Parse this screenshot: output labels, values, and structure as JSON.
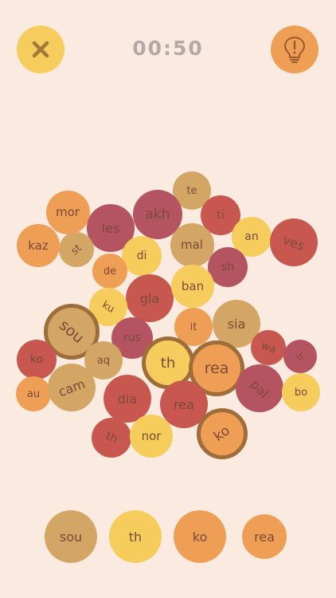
{
  "header": {
    "timer": "00:50",
    "close_icon": "close-x-icon",
    "hint_icon": "lightbulb-exclamation-icon"
  },
  "colors": {
    "background": "#fbeadf",
    "yellow": "#f6cd5c",
    "orange": "#ef9f55",
    "tan": "#d4a665",
    "red": "#c8584f",
    "maroon": "#b55461",
    "selected_border": "#9e6d3a",
    "text": "#7a4a3a",
    "timer": "#b3a9a6"
  },
  "bubbles": [
    {
      "text": "te",
      "color": "tan",
      "selected": false
    },
    {
      "text": "mor",
      "color": "orange",
      "selected": false
    },
    {
      "text": "les",
      "color": "maroon",
      "selected": false
    },
    {
      "text": "akh",
      "color": "maroon",
      "selected": false
    },
    {
      "text": "ti",
      "color": "red",
      "selected": false
    },
    {
      "text": "kaz",
      "color": "orange",
      "selected": false
    },
    {
      "text": "st",
      "color": "tan",
      "selected": false
    },
    {
      "text": "di",
      "color": "yellow",
      "selected": false
    },
    {
      "text": "mal",
      "color": "tan",
      "selected": false
    },
    {
      "text": "an",
      "color": "yellow",
      "selected": false
    },
    {
      "text": "ves",
      "color": "red",
      "selected": false
    },
    {
      "text": "de",
      "color": "orange",
      "selected": false
    },
    {
      "text": "sh",
      "color": "maroon",
      "selected": false
    },
    {
      "text": "gla",
      "color": "red",
      "selected": false
    },
    {
      "text": "ban",
      "color": "yellow",
      "selected": false
    },
    {
      "text": "ku",
      "color": "yellow",
      "selected": false
    },
    {
      "text": "sou",
      "color": "tan",
      "selected": true
    },
    {
      "text": "rus",
      "color": "maroon",
      "selected": false
    },
    {
      "text": "it",
      "color": "orange",
      "selected": false
    },
    {
      "text": "sia",
      "color": "tan",
      "selected": false
    },
    {
      "text": "ko",
      "color": "red",
      "selected": false
    },
    {
      "text": "aq",
      "color": "tan",
      "selected": false
    },
    {
      "text": "th",
      "color": "yellow",
      "selected": true
    },
    {
      "text": "rea",
      "color": "orange",
      "selected": true
    },
    {
      "text": "wa",
      "color": "red",
      "selected": false
    },
    {
      "text": "ir",
      "color": "maroon",
      "selected": false
    },
    {
      "text": "au",
      "color": "orange",
      "selected": false
    },
    {
      "text": "cam",
      "color": "tan",
      "selected": false
    },
    {
      "text": "pal",
      "color": "maroon",
      "selected": false
    },
    {
      "text": "bo",
      "color": "yellow",
      "selected": false
    },
    {
      "text": "dia",
      "color": "red",
      "selected": false
    },
    {
      "text": "rea",
      "color": "red",
      "selected": false
    },
    {
      "text": "ko",
      "color": "orange",
      "selected": true
    },
    {
      "text": "th",
      "color": "red",
      "selected": false
    },
    {
      "text": "nor",
      "color": "yellow",
      "selected": false
    }
  ],
  "tray": [
    {
      "text": "sou",
      "color": "tan"
    },
    {
      "text": "th",
      "color": "yellow"
    },
    {
      "text": "ko",
      "color": "orange"
    },
    {
      "text": "rea",
      "color": "orange"
    }
  ]
}
